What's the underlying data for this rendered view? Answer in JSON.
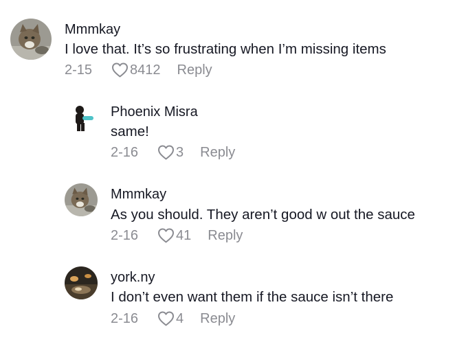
{
  "comments": [
    {
      "username": "Mmmkay",
      "text": "I love that. It’s so frustrating when I’m missing items",
      "date": "2-15",
      "likes": "8412",
      "reply_label": "Reply",
      "avatar_icon": "cat-avatar"
    },
    {
      "username": "Phoenix Misra",
      "text": "same!",
      "date": "2-16",
      "likes": "3",
      "reply_label": "Reply",
      "avatar_icon": "person-avatar"
    },
    {
      "username": "Mmmkay",
      "text": "As you should. They aren’t good w out the sauce",
      "date": "2-16",
      "likes": "41",
      "reply_label": "Reply",
      "avatar_icon": "cat-avatar"
    },
    {
      "username": "york.ny",
      "text": "I don’t even want them if the sauce isn’t there",
      "date": "2-16",
      "likes": "4",
      "reply_label": "Reply",
      "avatar_icon": "photo-avatar"
    }
  ],
  "colors": {
    "text_primary": "#161823",
    "text_secondary": "#8a8b91"
  }
}
